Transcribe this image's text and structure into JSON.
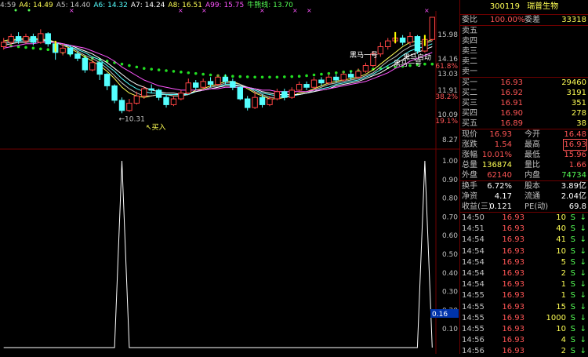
{
  "ma_header": [
    {
      "label": "4:59",
      "color": "#c0c0c0"
    },
    {
      "label": "A4: 14.49",
      "color": "#ffff55"
    },
    {
      "label": "A5: 14.40",
      "color": "#c0c0c0"
    },
    {
      "label": "A6: 14.32",
      "color": "#55ffff"
    },
    {
      "label": "A7: 14.24",
      "color": "#ffffff"
    },
    {
      "label": "A8: 16.51",
      "color": "#ffff55"
    },
    {
      "label": "A99: 15.75",
      "color": "#ff55ff"
    },
    {
      "label": "牛熊线: 13.70",
      "color": "#55ff55"
    }
  ],
  "price_axis": [
    {
      "value": "15.98",
      "color": "#c0c0c0"
    },
    {
      "value": "14.16",
      "color": "#c0c0c0"
    },
    {
      "value": "13.03",
      "color": "#c0c0c0"
    },
    {
      "value": "11.91",
      "color": "#c0c0c0"
    },
    {
      "value": "38.2%",
      "color": "#ff5555"
    },
    {
      "value": "10.09",
      "color": "#c0c0c0"
    },
    {
      "value": "19.1%",
      "color": "#ff5555"
    },
    {
      "value": "8.27",
      "color": "#c0c0c0"
    },
    {
      "value": "61.8%",
      "color": "#ff5555"
    }
  ],
  "indicator_axis": [
    "1.00",
    "0.90",
    "0.80",
    "0.70",
    "0.60",
    "0.50",
    "0.40",
    "0.30",
    "0.20",
    "0.10"
  ],
  "indicator_value": "0.16",
  "annotations": {
    "low_price": "10.31",
    "buy": "买入",
    "signal_1": "黑马一号",
    "signal_2": "黑马启动",
    "signal_3": "黑马一号"
  },
  "chart_data": {
    "type": "candlestick",
    "price_range": [
      8.27,
      16.93
    ],
    "candles": [
      {
        "o": 14.9,
        "c": 15.2,
        "h": 15.5,
        "l": 14.7
      },
      {
        "o": 15.2,
        "c": 15.6,
        "h": 15.8,
        "l": 15.0
      },
      {
        "o": 15.6,
        "c": 15.3,
        "h": 15.9,
        "l": 15.1
      },
      {
        "o": 15.3,
        "c": 15.6,
        "h": 15.8,
        "l": 15.1
      },
      {
        "o": 15.6,
        "c": 15.2,
        "h": 15.8,
        "l": 15.0
      },
      {
        "o": 15.2,
        "c": 15.8,
        "h": 16.1,
        "l": 15.1
      },
      {
        "o": 15.8,
        "c": 15.1,
        "h": 15.9,
        "l": 14.9
      },
      {
        "o": 15.1,
        "c": 14.5,
        "h": 15.2,
        "l": 14.0
      },
      {
        "o": 14.5,
        "c": 14.8,
        "h": 15.1,
        "l": 14.3
      },
      {
        "o": 14.8,
        "c": 14.4,
        "h": 15.0,
        "l": 14.2
      },
      {
        "o": 14.4,
        "c": 14.1,
        "h": 14.6,
        "l": 13.9
      },
      {
        "o": 14.1,
        "c": 13.3,
        "h": 14.2,
        "l": 13.1
      },
      {
        "o": 13.3,
        "c": 13.8,
        "h": 14.0,
        "l": 13.2
      },
      {
        "o": 13.8,
        "c": 13.0,
        "h": 13.9,
        "l": 12.6
      },
      {
        "o": 13.0,
        "c": 12.2,
        "h": 13.1,
        "l": 11.9
      },
      {
        "o": 12.2,
        "c": 11.2,
        "h": 12.3,
        "l": 11.0
      },
      {
        "o": 11.2,
        "c": 10.5,
        "h": 11.4,
        "l": 10.31
      },
      {
        "o": 10.5,
        "c": 11.0,
        "h": 11.3,
        "l": 10.4
      },
      {
        "o": 11.0,
        "c": 11.5,
        "h": 11.8,
        "l": 10.9
      },
      {
        "o": 11.5,
        "c": 12.0,
        "h": 12.2,
        "l": 11.3
      },
      {
        "o": 12.0,
        "c": 11.9,
        "h": 12.3,
        "l": 11.7
      },
      {
        "o": 11.9,
        "c": 11.4,
        "h": 12.0,
        "l": 11.2
      },
      {
        "o": 11.4,
        "c": 10.9,
        "h": 11.6,
        "l": 10.7
      },
      {
        "o": 10.9,
        "c": 11.3,
        "h": 11.5,
        "l": 10.8
      },
      {
        "o": 11.3,
        "c": 11.7,
        "h": 11.9,
        "l": 11.2
      },
      {
        "o": 11.7,
        "c": 12.4,
        "h": 12.7,
        "l": 11.6
      },
      {
        "o": 12.4,
        "c": 12.1,
        "h": 12.6,
        "l": 11.9
      },
      {
        "o": 12.1,
        "c": 12.5,
        "h": 12.7,
        "l": 12.0
      },
      {
        "o": 12.5,
        "c": 12.3,
        "h": 12.8,
        "l": 12.1
      },
      {
        "o": 12.3,
        "c": 12.8,
        "h": 13.0,
        "l": 12.2
      },
      {
        "o": 12.8,
        "c": 12.5,
        "h": 13.0,
        "l": 12.3
      },
      {
        "o": 12.5,
        "c": 12.1,
        "h": 12.7,
        "l": 11.9
      },
      {
        "o": 12.1,
        "c": 11.3,
        "h": 12.2,
        "l": 11.2
      },
      {
        "o": 11.3,
        "c": 10.7,
        "h": 11.5,
        "l": 10.5
      },
      {
        "o": 10.7,
        "c": 11.4,
        "h": 11.8,
        "l": 10.6
      },
      {
        "o": 11.4,
        "c": 10.9,
        "h": 11.6,
        "l": 10.7
      },
      {
        "o": 10.9,
        "c": 11.3,
        "h": 11.5,
        "l": 10.8
      },
      {
        "o": 11.3,
        "c": 11.8,
        "h": 12.0,
        "l": 11.2
      },
      {
        "o": 11.8,
        "c": 11.4,
        "h": 12.0,
        "l": 11.2
      },
      {
        "o": 11.4,
        "c": 11.9,
        "h": 12.1,
        "l": 11.3
      },
      {
        "o": 11.9,
        "c": 12.3,
        "h": 12.5,
        "l": 11.8
      },
      {
        "o": 12.3,
        "c": 12.1,
        "h": 12.5,
        "l": 11.9
      },
      {
        "o": 12.1,
        "c": 12.6,
        "h": 12.8,
        "l": 12.0
      },
      {
        "o": 12.6,
        "c": 12.4,
        "h": 12.8,
        "l": 12.2
      },
      {
        "o": 12.4,
        "c": 12.8,
        "h": 13.0,
        "l": 12.3
      },
      {
        "o": 12.8,
        "c": 12.6,
        "h": 13.0,
        "l": 12.4
      },
      {
        "o": 12.6,
        "c": 13.0,
        "h": 13.2,
        "l": 12.5
      },
      {
        "o": 13.0,
        "c": 12.8,
        "h": 13.2,
        "l": 12.6
      },
      {
        "o": 12.8,
        "c": 13.2,
        "h": 13.4,
        "l": 12.7
      },
      {
        "o": 13.2,
        "c": 13.6,
        "h": 13.8,
        "l": 13.1
      },
      {
        "o": 13.6,
        "c": 14.4,
        "h": 14.6,
        "l": 13.5
      },
      {
        "o": 14.4,
        "c": 14.9,
        "h": 15.2,
        "l": 14.2
      },
      {
        "o": 14.9,
        "c": 15.3,
        "h": 15.5,
        "l": 14.7
      },
      {
        "o": 15.3,
        "c": 15.5,
        "h": 15.8,
        "l": 15.1
      },
      {
        "o": 15.5,
        "c": 15.2,
        "h": 15.7,
        "l": 15.0
      },
      {
        "o": 15.2,
        "c": 15.6,
        "h": 15.9,
        "l": 15.0
      },
      {
        "o": 15.6,
        "c": 14.6,
        "h": 15.7,
        "l": 14.4
      },
      {
        "o": 14.6,
        "c": 15.4,
        "h": 15.6,
        "l": 14.5
      },
      {
        "o": 15.4,
        "c": 16.93,
        "h": 16.93,
        "l": 15.3
      }
    ],
    "ma_lines": [
      {
        "name": "A4",
        "color": "#ffff55",
        "values": [
          15.3,
          15.4,
          15.4,
          15.5,
          15.5,
          15.4,
          15.4,
          15.2,
          15.0,
          14.8,
          14.5,
          14.2,
          13.9,
          13.6,
          13.2,
          12.7,
          12.1,
          11.7,
          11.5,
          11.4,
          11.5,
          11.6,
          11.6,
          11.5,
          11.5,
          11.6,
          11.9,
          12.0,
          12.2,
          12.3,
          12.5,
          12.5,
          12.3,
          12.0,
          11.7,
          11.5,
          11.3,
          11.3,
          11.4,
          11.5,
          11.7,
          11.8,
          12.0,
          12.2,
          12.4,
          12.5,
          12.6,
          12.7,
          12.8,
          13.0,
          13.3,
          13.7,
          14.1,
          14.5,
          14.9,
          15.2,
          15.3,
          15.2,
          15.4
        ]
      },
      {
        "name": "A5",
        "color": "#c0c0c0",
        "values": [
          15.2,
          15.3,
          15.4,
          15.4,
          15.4,
          15.4,
          15.3,
          15.2,
          15.0,
          14.9,
          14.6,
          14.3,
          14.1,
          13.8,
          13.4,
          12.9,
          12.4,
          12.0,
          11.7,
          11.5,
          11.5,
          11.6,
          11.6,
          11.5,
          11.5,
          11.6,
          11.8,
          11.9,
          12.1,
          12.2,
          12.4,
          12.4,
          12.3,
          12.1,
          11.8,
          11.6,
          11.4,
          11.4,
          11.4,
          11.5,
          11.6,
          11.7,
          11.9,
          12.1,
          12.3,
          12.4,
          12.5,
          12.6,
          12.7,
          12.9,
          13.1,
          13.5,
          13.9,
          14.2,
          14.6,
          14.9,
          15.1,
          15.1,
          15.3
        ]
      },
      {
        "name": "A6",
        "color": "#55ffff",
        "values": [
          15.1,
          15.2,
          15.3,
          15.3,
          15.4,
          15.4,
          15.3,
          15.2,
          15.1,
          14.9,
          14.7,
          14.5,
          14.2,
          14.0,
          13.6,
          13.2,
          12.7,
          12.3,
          12.0,
          11.8,
          11.7,
          11.7,
          11.6,
          11.6,
          11.6,
          11.6,
          11.8,
          11.9,
          12.0,
          12.1,
          12.3,
          12.3,
          12.2,
          12.1,
          11.9,
          11.7,
          11.6,
          11.5,
          11.5,
          11.5,
          11.6,
          11.7,
          11.8,
          12.0,
          12.1,
          12.3,
          12.4,
          12.5,
          12.6,
          12.8,
          13.0,
          13.3,
          13.6,
          13.9,
          14.3,
          14.6,
          14.8,
          14.9,
          15.1
        ]
      },
      {
        "name": "A7",
        "color": "#ffffff",
        "values": [
          15.0,
          15.1,
          15.2,
          15.2,
          15.3,
          15.3,
          15.3,
          15.2,
          15.1,
          15.0,
          14.8,
          14.6,
          14.4,
          14.1,
          13.8,
          13.4,
          13.0,
          12.6,
          12.3,
          12.1,
          11.9,
          11.8,
          11.7,
          11.7,
          11.6,
          11.7,
          11.8,
          11.9,
          12.0,
          12.1,
          12.2,
          12.2,
          12.2,
          12.1,
          12.0,
          11.8,
          11.7,
          11.6,
          11.6,
          11.6,
          11.6,
          11.7,
          11.8,
          11.9,
          12.0,
          12.2,
          12.3,
          12.4,
          12.5,
          12.7,
          12.9,
          13.1,
          13.4,
          13.7,
          14.0,
          14.3,
          14.5,
          14.7,
          14.9
        ]
      },
      {
        "name": "A99",
        "color": "#ff55ff",
        "values": [
          14.8,
          14.9,
          15.0,
          15.1,
          15.1,
          15.2,
          15.2,
          15.2,
          15.1,
          15.0,
          14.9,
          14.8,
          14.6,
          14.4,
          14.2,
          13.9,
          13.5,
          13.2,
          12.9,
          12.6,
          12.4,
          12.2,
          12.1,
          12.0,
          11.9,
          11.9,
          11.9,
          11.9,
          12.0,
          12.0,
          12.1,
          12.1,
          12.1,
          12.1,
          12.0,
          11.9,
          11.9,
          11.8,
          11.8,
          11.8,
          11.8,
          11.8,
          11.9,
          11.9,
          12.0,
          12.1,
          12.2,
          12.3,
          12.4,
          12.5,
          12.7,
          12.9,
          13.1,
          13.4,
          13.6,
          13.9,
          14.1,
          14.3,
          14.5
        ]
      }
    ],
    "bull_bear_line": {
      "name": "牛熊线",
      "color": "#55ff55",
      "values": [
        15.0,
        14.95,
        14.9,
        14.85,
        14.8,
        14.75,
        14.7,
        14.6,
        14.5,
        14.4,
        14.3,
        14.2,
        14.1,
        14.0,
        13.9,
        13.8,
        13.7,
        13.6,
        13.5,
        13.4,
        13.35,
        13.3,
        13.25,
        13.2,
        13.15,
        13.1,
        13.05,
        13.0,
        12.95,
        12.9,
        12.88,
        12.86,
        12.84,
        12.82,
        12.8,
        12.8,
        12.8,
        12.8,
        12.82,
        12.84,
        12.86,
        12.9,
        12.95,
        13.0,
        13.05,
        13.1,
        13.15,
        13.2,
        13.25,
        13.3,
        13.35,
        13.4,
        13.45,
        13.5,
        13.55,
        13.6,
        13.65,
        13.7,
        13.7
      ]
    },
    "indicator": {
      "values": [
        0,
        0,
        0,
        0,
        0,
        0,
        0,
        0,
        0,
        0,
        0,
        0,
        0,
        0,
        0,
        0,
        1,
        0,
        0,
        0,
        0,
        0,
        0,
        0,
        0,
        0,
        0,
        0,
        0,
        0,
        0,
        0,
        0,
        0,
        0,
        0,
        0,
        0,
        0,
        0,
        0,
        0,
        0,
        0,
        0,
        0,
        0,
        0,
        0,
        0,
        0,
        0,
        0,
        0,
        0,
        0,
        0,
        1,
        0
      ],
      "range": [
        0,
        1
      ]
    }
  },
  "quote": {
    "code": "300119",
    "name": "瑞普生物",
    "weibi_label": "委比",
    "weibi_value": "100.00%",
    "weicha_label": "委差",
    "weicha_value": "33318",
    "sell": [
      {
        "label": "卖五",
        "price": "",
        "qty": ""
      },
      {
        "label": "卖四",
        "price": "",
        "qty": ""
      },
      {
        "label": "卖三",
        "price": "",
        "qty": ""
      },
      {
        "label": "卖二",
        "price": "",
        "qty": ""
      },
      {
        "label": "卖一",
        "price": "",
        "qty": ""
      }
    ],
    "buy": [
      {
        "label": "买一",
        "price": "16.93",
        "qty": "29460"
      },
      {
        "label": "买二",
        "price": "16.92",
        "qty": "3191"
      },
      {
        "label": "买三",
        "price": "16.91",
        "qty": "351"
      },
      {
        "label": "买四",
        "price": "16.90",
        "qty": "278"
      },
      {
        "label": "买五",
        "price": "16.89",
        "qty": "38"
      }
    ],
    "stats": [
      {
        "l1": "现价",
        "v1": "16.93",
        "c1": "red",
        "l2": "今开",
        "v2": "16.48",
        "c2": "red"
      },
      {
        "l1": "涨跌",
        "v1": "1.54",
        "c1": "red",
        "l2": "最高",
        "v2": "16.93",
        "c2": "red",
        "box2": true
      },
      {
        "l1": "涨幅",
        "v1": "10.01%",
        "c1": "red",
        "l2": "最低",
        "v2": "15.96",
        "c2": "red"
      },
      {
        "l1": "总量",
        "v1": "136874",
        "c1": "yel",
        "l2": "量比",
        "v2": "1.66",
        "c2": "red"
      },
      {
        "l1": "外盘",
        "v1": "62140",
        "c1": "red",
        "l2": "内盘",
        "v2": "74734",
        "c2": "grn"
      }
    ],
    "stats2": [
      {
        "l1": "换手",
        "v1": "6.72%",
        "l2": "股本",
        "v2": "3.89亿"
      },
      {
        "l1": "净资",
        "v1": "4.17",
        "l2": "流通",
        "v2": "2.04亿"
      },
      {
        "l1": "收益(三)",
        "v1": "0.121",
        "l2": "PE(动)",
        "v2": "69.8"
      }
    ],
    "ticks": [
      {
        "time": "14:50",
        "price": "16.93",
        "vol": "10",
        "bs": "S",
        "ind": "↓",
        "vcol": "yel"
      },
      {
        "time": "14:51",
        "price": "16.93",
        "vol": "40",
        "bs": "S",
        "ind": "↓",
        "vcol": "yel"
      },
      {
        "time": "14:54",
        "price": "16.93",
        "vol": "41",
        "bs": "S",
        "ind": "↓",
        "vcol": "yel"
      },
      {
        "time": "14:54",
        "price": "16.93",
        "vol": "10",
        "bs": "S",
        "ind": "↓",
        "vcol": "yel"
      },
      {
        "time": "14:54",
        "price": "16.93",
        "vol": "5",
        "bs": "S",
        "ind": "↓",
        "vcol": "yel"
      },
      {
        "time": "14:54",
        "price": "16.93",
        "vol": "2",
        "bs": "S",
        "ind": "↓",
        "vcol": "yel"
      },
      {
        "time": "14:54",
        "price": "16.93",
        "vol": "1",
        "bs": "S",
        "ind": "↓",
        "vcol": "yel"
      },
      {
        "time": "14:55",
        "price": "16.93",
        "vol": "1",
        "bs": "S",
        "ind": "↓",
        "vcol": "yel"
      },
      {
        "time": "14:55",
        "price": "16.93",
        "vol": "15",
        "bs": "S",
        "ind": "↓",
        "vcol": "yel"
      },
      {
        "time": "14:55",
        "price": "16.93",
        "vol": "1000",
        "bs": "S",
        "ind": "↓",
        "vcol": "mag"
      },
      {
        "time": "14:55",
        "price": "16.93",
        "vol": "10",
        "bs": "S",
        "ind": "↓",
        "vcol": "yel"
      },
      {
        "time": "14:56",
        "price": "16.93",
        "vol": "4",
        "bs": "S",
        "ind": "↓",
        "vcol": "yel"
      },
      {
        "time": "14:56",
        "price": "16.93",
        "vol": "2",
        "bs": "S",
        "ind": "↓",
        "vcol": "yel"
      }
    ]
  }
}
